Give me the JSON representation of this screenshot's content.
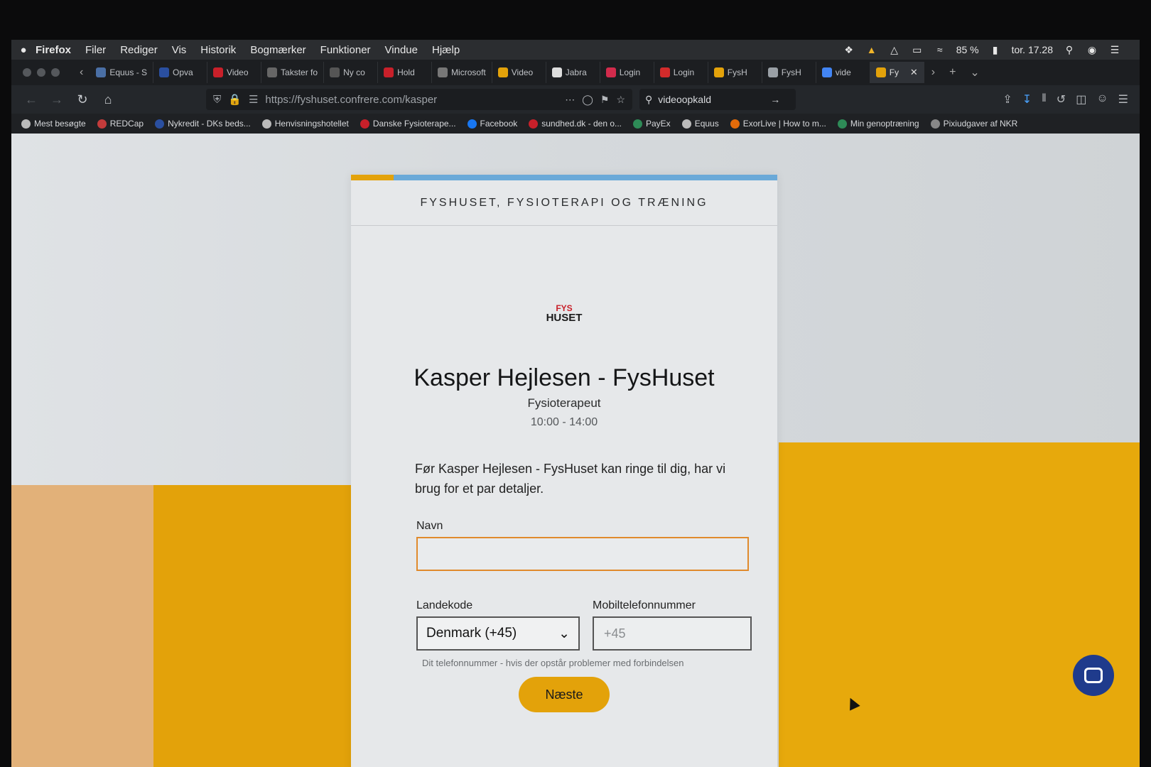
{
  "menubar": {
    "apple_icon": "apple-icon",
    "app_name": "Firefox",
    "menus": [
      "Filer",
      "Rediger",
      "Vis",
      "Historik",
      "Bogmærker",
      "Funktioner",
      "Vindue",
      "Hjælp"
    ],
    "battery": "85 %",
    "clock": "tor. 17.28"
  },
  "tabs": [
    {
      "label": "Equus - S",
      "color": "#4a6fa5"
    },
    {
      "label": "Opva",
      "color": "#2a4fa0"
    },
    {
      "label": "Video",
      "color": "#c8202a"
    },
    {
      "label": "Takster fo",
      "color": "#666666"
    },
    {
      "label": "Ny co",
      "color": "#555555"
    },
    {
      "label": "Hold",
      "color": "#c8202a"
    },
    {
      "label": "Microsoft",
      "color": "#777777"
    },
    {
      "label": "Video",
      "color": "#e3a20a"
    },
    {
      "label": "Jabra",
      "color": "#dddddd"
    },
    {
      "label": "Login",
      "color": "#d22b4c"
    },
    {
      "label": "Login",
      "color": "#d22b2b"
    },
    {
      "label": "FysH",
      "color": "#e3a20a"
    },
    {
      "label": "FysH",
      "color": "#9aa0a6"
    },
    {
      "label": "vide",
      "color": "#4285f4"
    },
    {
      "label": "Fy",
      "color": "#e3a20a",
      "active": true
    }
  ],
  "nav": {
    "url": "https://fyshuset.confrere.com/kasper",
    "search_value": "videoopkald"
  },
  "bookmarks": [
    {
      "label": "Mest besøgte",
      "color": "#bbbbbb"
    },
    {
      "label": "REDCap",
      "color": "#c33b3b"
    },
    {
      "label": "Nykredit - DKs beds...",
      "color": "#2a4fa0"
    },
    {
      "label": "Henvisningshotellet",
      "color": "#bbbbbb"
    },
    {
      "label": "Danske Fysioterape...",
      "color": "#c8202a"
    },
    {
      "label": "Facebook",
      "color": "#1877f2"
    },
    {
      "label": "sundhed.dk - den o...",
      "color": "#c8202a"
    },
    {
      "label": "PayEx",
      "color": "#2e8b57"
    },
    {
      "label": "Equus",
      "color": "#bbbbbb"
    },
    {
      "label": "ExorLive | How to m...",
      "color": "#e36b0a"
    },
    {
      "label": "Min genoptræning",
      "color": "#2e8b57"
    },
    {
      "label": "Pixiudgaver af NKR",
      "color": "#888888"
    }
  ],
  "card": {
    "org_title": "FYSHUSET, FYSIOTERAPI OG TRÆNING",
    "progress_fraction": 0.1,
    "logo_line1": "FYS",
    "logo_line2": "HUSET",
    "host_name": "Kasper Hejlesen - FysHuset",
    "role": "Fysioterapeut",
    "hours": "10:00 - 14:00",
    "intro": "Før Kasper Hejlesen - FysHuset kan ringe til dig, har vi brug for et par detaljer.",
    "name_label": "Navn",
    "name_value": "",
    "country_label": "Landekode",
    "country_value": "Denmark (+45)",
    "phone_label": "Mobiltelefonnummer",
    "phone_placeholder": "+45",
    "phone_hint": "Dit telefonnummer - hvis der opstår problemer med forbindelsen",
    "next_label": "Næste"
  },
  "colors": {
    "accent_yellow": "#e3a20a",
    "progress_blue": "#6aa9d8",
    "input_focus": "#e08a2c",
    "chat_blue": "#1f3b8c"
  }
}
